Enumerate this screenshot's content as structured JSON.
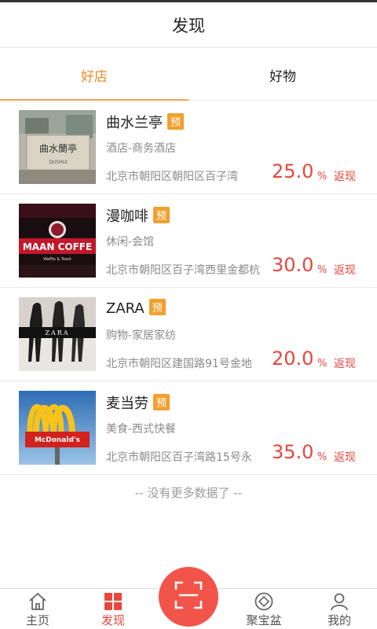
{
  "header": {
    "title": "发现"
  },
  "tabs": [
    {
      "label": "好店",
      "active": true
    },
    {
      "label": "好物",
      "active": false
    }
  ],
  "stores": [
    {
      "name": "曲水兰亭",
      "badge": "预",
      "category": "酒店-商务酒店",
      "address": "北京市朝阳区朝阳区百子湾",
      "rate": "25.0",
      "percent": "%",
      "cashback": "返现",
      "image": "hotel-sign"
    },
    {
      "name": "漫咖啡",
      "badge": "预",
      "category": "休闲-会馆",
      "address": "北京市朝阳区百子湾西里金都杭",
      "rate": "30.0",
      "percent": "%",
      "cashback": "返现",
      "image": "maan-coffee-sign",
      "image_text": "MAAN COFFE"
    },
    {
      "name": "ZARA",
      "badge": "预",
      "category": "购物-家居家纺",
      "address": "北京市朝阳区建国路91号金地",
      "rate": "20.0",
      "percent": "%",
      "cashback": "返现",
      "image": "zara-models",
      "image_text": "ZARA"
    },
    {
      "name": "麦当劳",
      "badge": "预",
      "category": "美食-西式快餐",
      "address": "北京市朝阳区百子湾路15号永",
      "rate": "35.0",
      "percent": "%",
      "cashback": "返现",
      "image": "mcdonalds-sign",
      "image_text": "McDonald's"
    }
  ],
  "footer_note": "-- 没有更多数据了 --",
  "tabbar": [
    {
      "label": "主页",
      "icon": "home-icon",
      "active": false
    },
    {
      "label": "发现",
      "icon": "grid-icon",
      "active": true
    },
    {
      "label": "聚宝盆",
      "icon": "treasure-icon",
      "active": false
    },
    {
      "label": "我的",
      "icon": "user-icon",
      "active": false
    }
  ],
  "scan_button": {
    "icon": "scan-icon"
  },
  "colors": {
    "accent": "#f08a24",
    "red": "#e9463c",
    "badge": "#f0a030"
  }
}
